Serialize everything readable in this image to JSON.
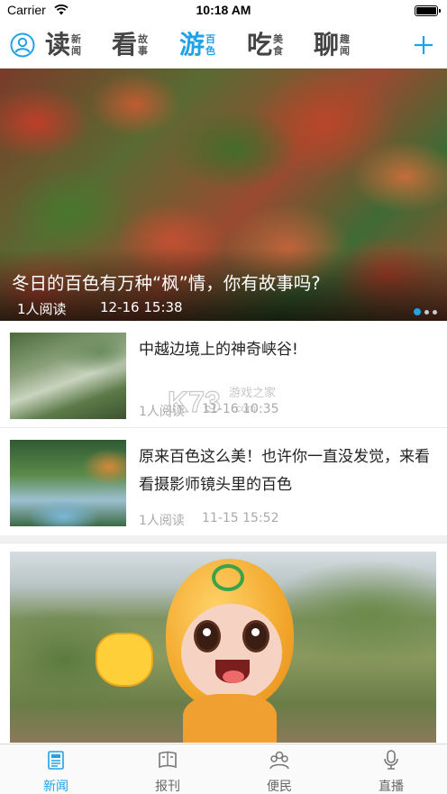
{
  "status_bar": {
    "carrier": "Carrier",
    "time": "10:18 AM"
  },
  "nav": {
    "tabs": [
      {
        "big": "读",
        "small_top": "新",
        "small_bottom": "闻",
        "active": false
      },
      {
        "big": "看",
        "small_top": "故",
        "small_bottom": "事",
        "active": false
      },
      {
        "big": "游",
        "small_top": "百",
        "small_bottom": "色",
        "active": true
      },
      {
        "big": "吃",
        "small_top": "美",
        "small_bottom": "食",
        "active": false
      },
      {
        "big": "聊",
        "small_top": "趣",
        "small_bottom": "闻",
        "active": false
      }
    ],
    "accent_color": "#1fa2e6"
  },
  "hero": {
    "title": "冬日的百色有万种“枫”情，你有故事吗?",
    "reads": "1人阅读",
    "time": "12-16 15:38",
    "carousel_pages": 3,
    "carousel_active": 1
  },
  "news": [
    {
      "title": "中越边境上的神奇峡谷!",
      "reads": "1人阅读",
      "time": "11-16 10:35"
    },
    {
      "title": "原来百色这么美！也许你一直没发觉，来看看摄影师镜头里的百色",
      "reads": "1人阅读",
      "time": "11-15 15:52"
    }
  ],
  "tabbar": [
    {
      "label": "新闻",
      "icon": "newspaper-icon",
      "active": true
    },
    {
      "label": "报刊",
      "icon": "magazine-icon",
      "active": false
    },
    {
      "label": "便民",
      "icon": "people-icon",
      "active": false
    },
    {
      "label": "直播",
      "icon": "microphone-icon",
      "active": false
    }
  ],
  "watermark": {
    "brand": "K73",
    "text": "游戏之家",
    "domain": ".com"
  }
}
